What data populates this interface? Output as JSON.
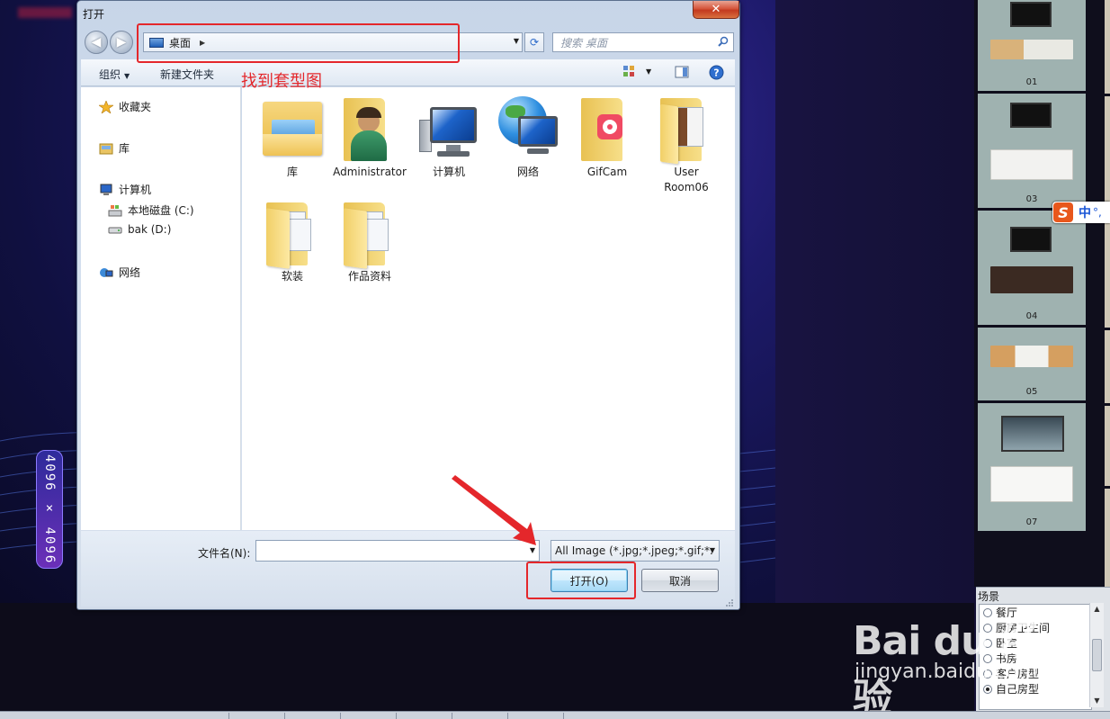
{
  "dialog": {
    "title": "打开",
    "close_glyph": "✕",
    "address": {
      "location": "桌面",
      "chevron": "▶"
    },
    "search": {
      "placeholder": "搜索 桌面"
    },
    "toolbar": {
      "organize": "组织",
      "new_folder": "新建文件夹"
    },
    "nav_pane": {
      "favorites": "收藏夹",
      "libraries": "库",
      "computer": "计算机",
      "drive_c": "本地磁盘 (C:)",
      "drive_d": "bak (D:)",
      "network": "网络"
    },
    "files": [
      {
        "name": "库"
      },
      {
        "name": "Administrator"
      },
      {
        "name": "计算机"
      },
      {
        "name": "网络"
      },
      {
        "name": "GifCam"
      },
      {
        "name": "User Room06"
      },
      {
        "name": "软装"
      },
      {
        "name": "作品资料"
      }
    ],
    "file_name": {
      "label": "文件名(N):",
      "value": ""
    },
    "file_type": {
      "value": "All Image (*.jpg;*.jpeg;*.gif;*."
    },
    "buttons": {
      "open": "打开(O)",
      "cancel": "取消"
    }
  },
  "annotation": {
    "text": "找到套型图",
    "color": "#e4272b"
  },
  "background": {
    "resolution_badge": "4096 × 4096",
    "thumbnails": [
      "01",
      "03",
      "04",
      "05",
      "07"
    ],
    "ime": {
      "logo": "S",
      "mode": "中",
      "punct": "°,"
    }
  },
  "scene_panel": {
    "title": "场景",
    "items": [
      {
        "label": "餐厅",
        "selected": false
      },
      {
        "label": "厨房卫生间",
        "selected": false
      },
      {
        "label": "卧室",
        "selected": false
      },
      {
        "label": "书房",
        "selected": false
      },
      {
        "label": "客户房型",
        "selected": false
      },
      {
        "label": "自己房型",
        "selected": true
      }
    ]
  },
  "watermark": {
    "top": "Bai du 经验",
    "bottom": "jingyan.baidu.com"
  },
  "colors": {
    "accent_red": "#e4272b",
    "dialog_bg": "#d8e3f0",
    "close_red": "#c3391f"
  }
}
